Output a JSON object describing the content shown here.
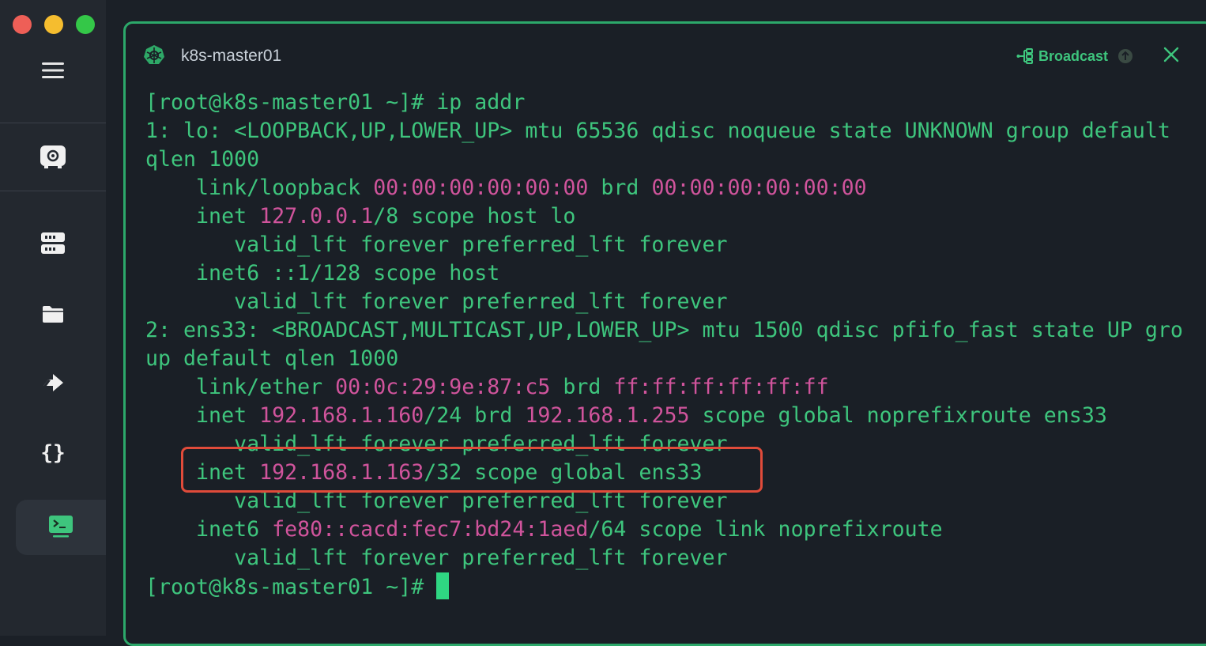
{
  "window": {
    "controls": [
      "close",
      "minimize",
      "zoom"
    ]
  },
  "sidebar": {
    "items": [
      {
        "icon": "menu-icon"
      },
      {
        "icon": "vault-icon"
      },
      {
        "icon": "hosts-icon"
      },
      {
        "icon": "sftp-folder-icon"
      },
      {
        "icon": "port-forwarding-icon"
      },
      {
        "icon": "snippets-braces-icon"
      },
      {
        "icon": "terminal-icon",
        "active": true
      }
    ]
  },
  "tab": {
    "title": "k8s-master01",
    "broadcast_label": "Broadcast"
  },
  "terminal": {
    "lines": [
      [
        {
          "t": "[root@k8s-master01 ~]# ip addr"
        }
      ],
      [
        {
          "t": "1: lo: <LOOPBACK,UP,LOWER_UP> mtu 65536 qdisc noqueue state UNKNOWN group default"
        }
      ],
      [
        {
          "t": "qlen 1000"
        }
      ],
      [
        {
          "t": "    link/loopback "
        },
        {
          "t": "00:00:00:00:00:00",
          "c": "m"
        },
        {
          "t": " brd "
        },
        {
          "t": "00:00:00:00:00:00",
          "c": "m"
        }
      ],
      [
        {
          "t": "    inet "
        },
        {
          "t": "127.0.0.1",
          "c": "m"
        },
        {
          "t": "/8 scope host lo"
        }
      ],
      [
        {
          "t": "       valid_lft forever preferred_lft forever"
        }
      ],
      [
        {
          "t": "    inet6 ::1/128 scope host"
        }
      ],
      [
        {
          "t": "       valid_lft forever preferred_lft forever"
        }
      ],
      [
        {
          "t": "2: ens33: <BROADCAST,MULTICAST,UP,LOWER_UP> mtu 1500 qdisc pfifo_fast state UP gro"
        }
      ],
      [
        {
          "t": "up default qlen 1000"
        }
      ],
      [
        {
          "t": "    link/ether "
        },
        {
          "t": "00:0c:29:9e:87:c5",
          "c": "m"
        },
        {
          "t": " brd "
        },
        {
          "t": "ff:ff:ff:ff:ff:ff",
          "c": "m"
        }
      ],
      [
        {
          "t": "    inet "
        },
        {
          "t": "192.168.1.160",
          "c": "m"
        },
        {
          "t": "/24 brd "
        },
        {
          "t": "192.168.1.255",
          "c": "m"
        },
        {
          "t": " scope global noprefixroute ens33"
        }
      ],
      [
        {
          "t": "       valid_lft forever preferred_lft forever"
        }
      ],
      [
        {
          "t": "    inet "
        },
        {
          "t": "192.168.1.163",
          "c": "m"
        },
        {
          "t": "/32 scope global ens33"
        }
      ],
      [
        {
          "t": "       valid_lft forever preferred_lft forever"
        }
      ],
      [
        {
          "t": "    inet6 "
        },
        {
          "t": "fe80::cacd:fec7:bd24:1aed",
          "c": "m"
        },
        {
          "t": "/64 scope link noprefixroute"
        }
      ],
      [
        {
          "t": "       valid_lft forever preferred_lft forever"
        }
      ],
      [
        {
          "t": "[root@k8s-master01 ~]# "
        }
      ]
    ],
    "highlighted_line_index": 13
  },
  "colors": {
    "accent": "#3ec57d",
    "magenta": "#d0549c",
    "highlight_box": "#e04b3a",
    "terminal_border": "#2ca86a"
  }
}
